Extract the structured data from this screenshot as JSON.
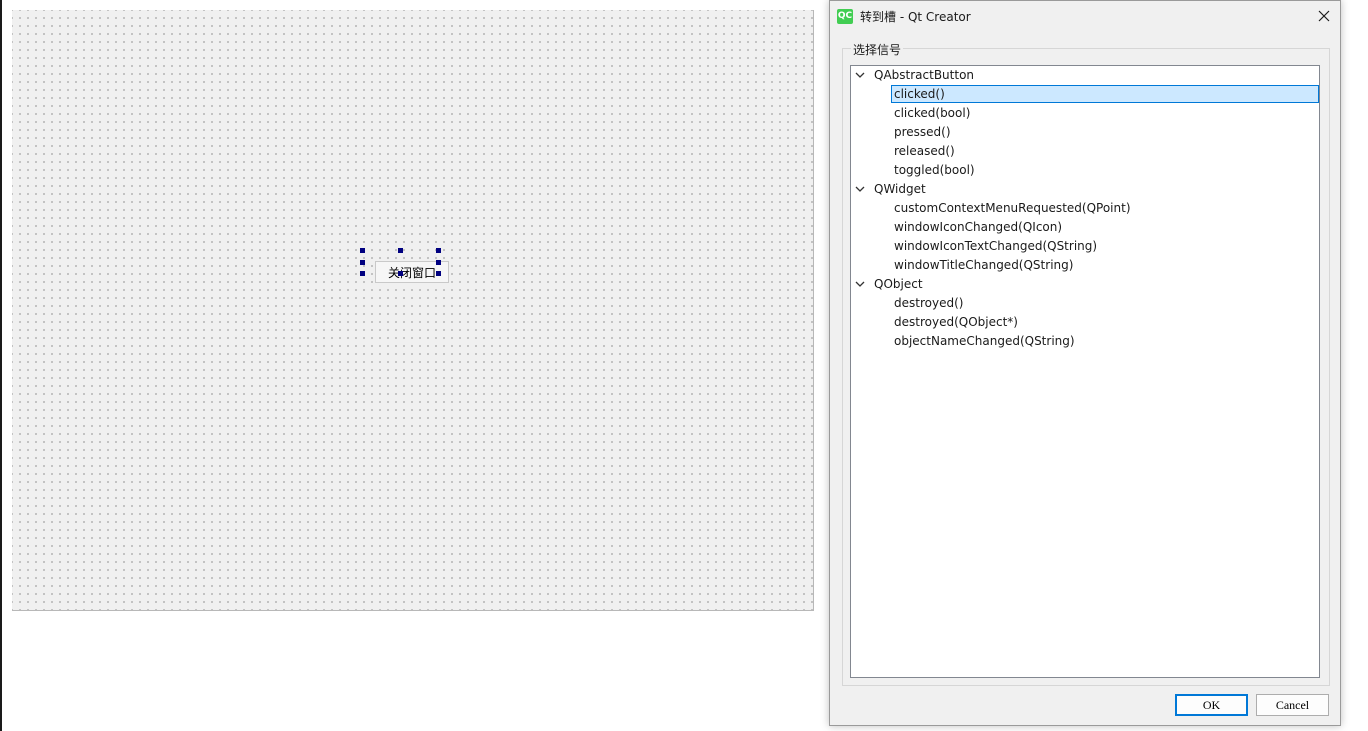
{
  "designer": {
    "push_button_text": "关闭窗口"
  },
  "dialog": {
    "app_icon_text": "QC",
    "title": "转到槽 - Qt Creator",
    "group_label": "选择信号",
    "tree": [
      {
        "label": "QAbstractButton",
        "kind": "parent"
      },
      {
        "label": "clicked()",
        "kind": "child",
        "selected": true
      },
      {
        "label": "clicked(bool)",
        "kind": "child"
      },
      {
        "label": "pressed()",
        "kind": "child"
      },
      {
        "label": "released()",
        "kind": "child"
      },
      {
        "label": "toggled(bool)",
        "kind": "child"
      },
      {
        "label": "QWidget",
        "kind": "parent"
      },
      {
        "label": "customContextMenuRequested(QPoint)",
        "kind": "child"
      },
      {
        "label": "windowIconChanged(QIcon)",
        "kind": "child"
      },
      {
        "label": "windowIconTextChanged(QString)",
        "kind": "child"
      },
      {
        "label": "windowTitleChanged(QString)",
        "kind": "child"
      },
      {
        "label": "QObject",
        "kind": "parent"
      },
      {
        "label": "destroyed()",
        "kind": "child"
      },
      {
        "label": "destroyed(QObject*)",
        "kind": "child"
      },
      {
        "label": "objectNameChanged(QString)",
        "kind": "child"
      }
    ],
    "ok_label": "OK",
    "cancel_label": "Cancel"
  },
  "colors": {
    "selection_fill": "#cce8ff",
    "selection_border": "#0078d7",
    "handle": "#000080",
    "qt_green": "#41cd52"
  }
}
